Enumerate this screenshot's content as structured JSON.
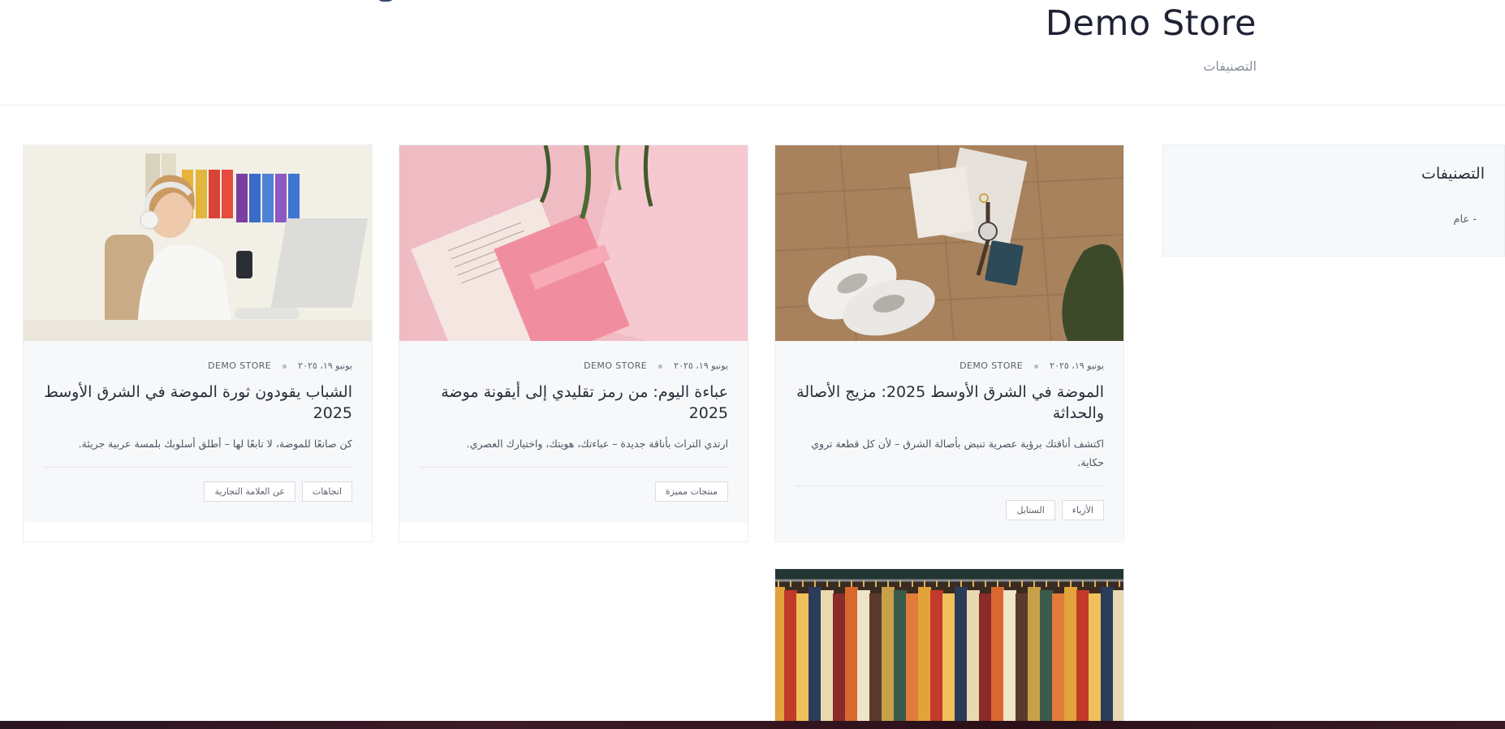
{
  "header": {
    "store_title": "Demo Store",
    "breadcrumb": "التصنيفات"
  },
  "sidebar": {
    "title": "التصنيفات",
    "items": [
      {
        "label": "- عام"
      }
    ]
  },
  "posts": [
    {
      "date": "يونيو ١٩، ٢٠٢٥",
      "author": "DEMO STORE",
      "title": "الموضة في الشرق الأوسط 2025: مزيج الأصالة والحداثة",
      "excerpt": "اكتشف أناقتك برؤية عصرية تنبض بأصالة الشرق – لأن كل قطعة تروي حكاية.",
      "tags": [
        "الأزياء",
        "الستايل"
      ]
    },
    {
      "date": "يونيو ١٩، ٢٠٢٥",
      "author": "DEMO STORE",
      "title": "عباءة اليوم: من رمز تقليدي إلى أيقونة موضة 2025",
      "excerpt": "ارتدي التراث بأناقة جديدة – عباءتك، هويتك، واختيارك العصري.",
      "tags": [
        "منتجات مميزة"
      ]
    },
    {
      "date": "يونيو ١٩، ٢٠٢٥",
      "author": "DEMO STORE",
      "title": "الشباب يقودون ثورة الموضة في الشرق الأوسط 2025",
      "excerpt": "كن صانعًا للموضة، لا تابعًا لها – أطلق أسلوبك بلمسة عربية جريئة.",
      "tags": [
        "اتجاهات",
        "عن العلامة التجارية"
      ]
    }
  ],
  "colors": {
    "text": "#2a2d3a",
    "muted": "#8a8f9c",
    "card_body": "#f7f8fa",
    "border": "#eceef2"
  }
}
